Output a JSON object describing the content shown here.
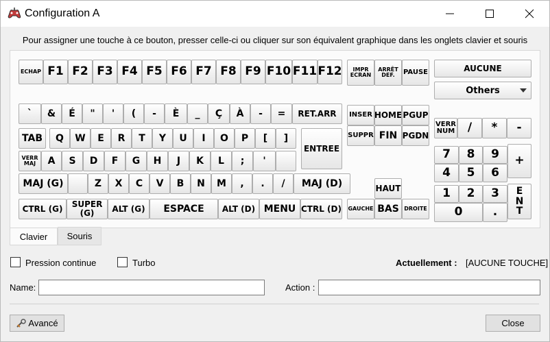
{
  "window": {
    "title": "Configuration A",
    "controls": [
      "minimize-icon",
      "maximize-icon",
      "close-icon"
    ]
  },
  "instruction": "Pour assigner une touche à ce bouton, presser celle-ci ou cliquer sur son équivalent graphique dans les onglets clavier et souris",
  "keyboard": {
    "function_row": [
      "ECHAP",
      "F1",
      "F2",
      "F3",
      "F4",
      "F5",
      "F6",
      "F7",
      "F8",
      "F9",
      "F10",
      "F11",
      "F12"
    ],
    "system_keys": [
      "IMPR ECRAN",
      "ARRÊT DEF.",
      "PAUSE"
    ],
    "number_row": [
      "`",
      "&",
      "É",
      "\"",
      "'",
      "(",
      "-",
      "È",
      "_",
      "Ç",
      "À",
      "-",
      "=",
      "RET.ARR"
    ],
    "row_q": [
      "TAB",
      "Q",
      "W",
      "E",
      "R",
      "T",
      "Y",
      "U",
      "I",
      "O",
      "P",
      "[",
      "]"
    ],
    "entree": "ENTREE",
    "row_a": [
      "VERR MAJ",
      "A",
      "S",
      "D",
      "F",
      "G",
      "H",
      "J",
      "K",
      "L",
      ";",
      "'",
      ""
    ],
    "row_z": [
      "MAJ (G)",
      "",
      "Z",
      "X",
      "C",
      "V",
      "B",
      "N",
      "M",
      ",",
      ".",
      "/",
      "MAJ (D)"
    ],
    "bottom_row": [
      "CTRL (G)",
      "SUPER (G)",
      "ALT (G)",
      "ESPACE",
      "ALT (D)",
      "MENU",
      "CTRL (D)"
    ],
    "nav_keys": [
      "INSER",
      "HOME",
      "PGUP",
      "SUPPR",
      "FIN",
      "PGDN"
    ],
    "arrows": {
      "up": "HAUT",
      "left": "GAUCHE",
      "down": "BAS",
      "right": "DROITE"
    },
    "numpad": {
      "row0": [
        "VERR\nNUM",
        "/",
        "*",
        "-"
      ],
      "row1": [
        "7",
        "8",
        "9"
      ],
      "row2": [
        "4",
        "5",
        "6"
      ],
      "row3": [
        "1",
        "2",
        "3"
      ],
      "plus": "+",
      "enter": "E\nN\nT",
      "zero": "0",
      "dot": "."
    },
    "aucune": "AUCUNE",
    "others": "Others"
  },
  "tabs": [
    "Clavier",
    "Souris"
  ],
  "options": {
    "pression_continue": "Pression continue",
    "turbo": "Turbo",
    "current_label": "Actuellement :",
    "current_value": "[AUCUNE TOUCHE]"
  },
  "fields": {
    "name_label": "Name:",
    "name_value": "",
    "action_label": "Action :",
    "action_value": ""
  },
  "footer": {
    "avance": "Avancé",
    "close": "Close"
  }
}
